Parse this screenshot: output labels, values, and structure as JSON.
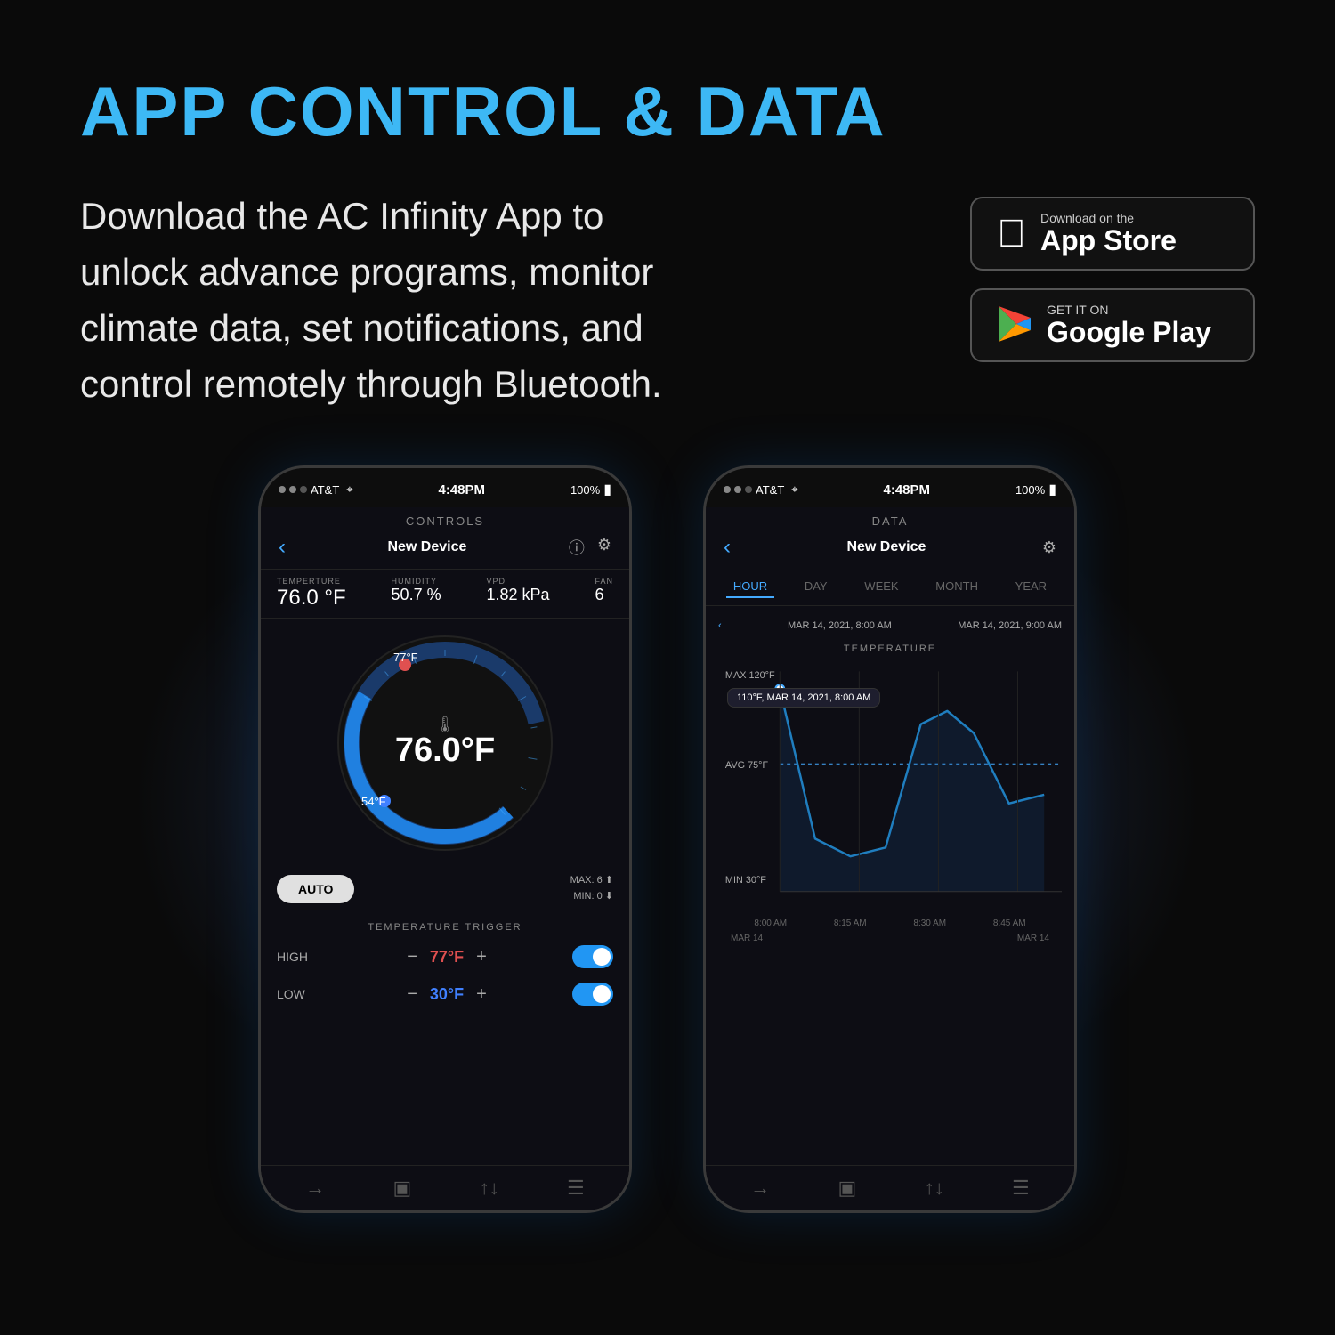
{
  "page": {
    "title": "APP CONTROL & DATA",
    "description": "Download the AC Infinity App to unlock advance programs, monitor climate data, set notifications, and control remotely through Bluetooth.",
    "background_color": "#0a0a0a"
  },
  "store_buttons": {
    "appstore": {
      "small_text": "Download on the",
      "big_text": "App Store"
    },
    "googleplay": {
      "small_text": "GET IT ON",
      "big_text": "Google Play"
    }
  },
  "phone1": {
    "status_bar": {
      "carrier": "AT&T",
      "time": "4:48PM",
      "battery": "100%"
    },
    "screen_title": "CONTROLS",
    "device_name": "New Device",
    "sensors": {
      "temperature": {
        "label": "TEMPERTURE",
        "value": "76.0 °F"
      },
      "humidity": {
        "label": "HUMIDITY",
        "value": "50.7 %"
      },
      "vpd": {
        "label": "VPD",
        "value": "1.82 kPa"
      },
      "fan": {
        "label": "FAN",
        "value": "6"
      }
    },
    "gauge": {
      "current_temp": "76.0°F",
      "high_marker": "77°F",
      "low_marker": "54°F"
    },
    "auto_button": "AUTO",
    "max_min": "MAX: 6\nMIN: 0",
    "trigger_section_title": "TEMPERATURE TRIGGER",
    "triggers": [
      {
        "label": "HIGH",
        "value": "77°F",
        "color": "red",
        "enabled": true
      },
      {
        "label": "LOW",
        "value": "30°F",
        "color": "blue",
        "enabled": true
      }
    ]
  },
  "phone2": {
    "status_bar": {
      "carrier": "AT&T",
      "time": "4:48PM",
      "battery": "100%"
    },
    "screen_title": "DATA",
    "device_name": "New Device",
    "time_tabs": [
      "HOUR",
      "DAY",
      "WEEK",
      "MONTH",
      "YEAR"
    ],
    "active_tab": "HOUR",
    "date_range_start": "MAR 14, 2021, 8:00 AM",
    "date_range_end": "MAR 14, 2021, 9:00 AM",
    "chart_title": "TEMPERATURE",
    "tooltip": "110°F, MAR 14, 2021, 8:00 AM",
    "chart": {
      "y_labels": [
        "MAX 120°F",
        "AVG 75°F",
        "MIN 30°F"
      ],
      "x_labels": [
        "8:00 AM",
        "8:15 AM",
        "8:30 AM",
        "8:45 AM"
      ],
      "dates": [
        "MAR 14",
        "MAR 14"
      ]
    }
  }
}
